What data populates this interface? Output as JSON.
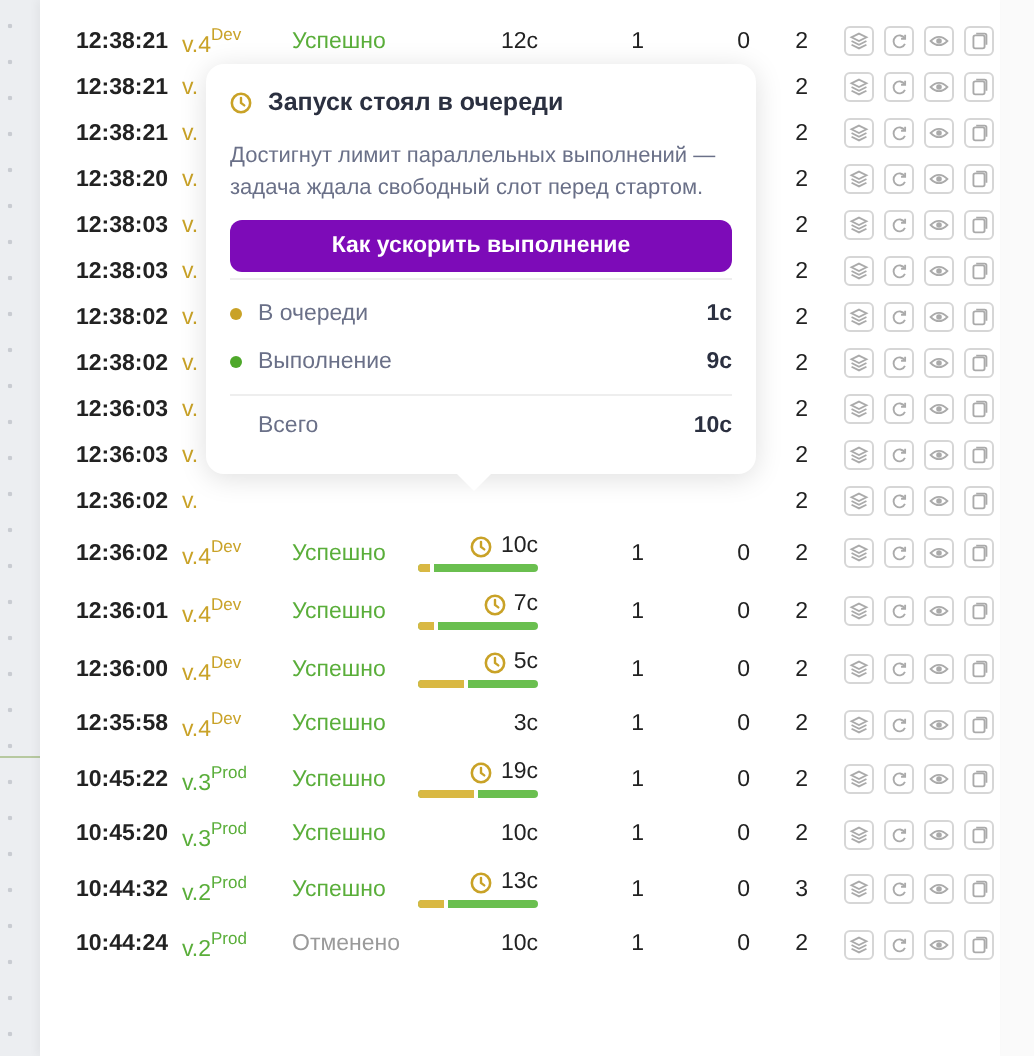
{
  "rows": [
    {
      "time": "12:38:21",
      "version": "v.4",
      "env": "Dev",
      "color": "#c9a227",
      "status": "Успешно",
      "cancelled": false,
      "duration": "12с",
      "col_1": "1",
      "col_2": "0",
      "col_3": "2"
    },
    {
      "time": "12:38:21",
      "version": "v.",
      "col_3": "2"
    },
    {
      "time": "12:38:21",
      "version": "v.",
      "col_3": "2"
    },
    {
      "time": "12:38:20",
      "version": "v.",
      "col_3": "2"
    },
    {
      "time": "12:38:03",
      "version": "v.",
      "col_3": "2"
    },
    {
      "time": "12:38:03",
      "version": "v.",
      "col_3": "2"
    },
    {
      "time": "12:38:02",
      "version": "v.",
      "col_3": "2"
    },
    {
      "time": "12:38:02",
      "version": "v.",
      "col_3": "2"
    },
    {
      "time": "12:36:03",
      "version": "v.",
      "col_3": "2"
    },
    {
      "time": "12:36:03",
      "version": "v.",
      "col_3": "2"
    },
    {
      "time": "12:36:02",
      "version": "v.",
      "col_3": "2"
    },
    {
      "time": "12:36:02",
      "version": "v.4",
      "env": "Dev",
      "color": "#c9a227",
      "status": "Успешно",
      "cancelled": false,
      "duration": "10с",
      "queued": true,
      "level": 0.1,
      "col_1": "1",
      "col_2": "0",
      "col_3": "2"
    },
    {
      "time": "12:36:01",
      "version": "v.4",
      "env": "Dev",
      "color": "#c9a227",
      "status": "Успешно",
      "cancelled": false,
      "duration": "7с",
      "queued": true,
      "level": 0.13,
      "col_1": "1",
      "col_2": "0",
      "col_3": "2"
    },
    {
      "time": "12:36:00",
      "version": "v.4",
      "env": "Dev",
      "color": "#c9a227",
      "status": "Успешно",
      "cancelled": false,
      "duration": "5с",
      "queued": true,
      "level": 0.39,
      "col_1": "1",
      "col_2": "0",
      "col_3": "2"
    },
    {
      "time": "12:35:58",
      "version": "v.4",
      "env": "Dev",
      "color": "#c9a227",
      "status": "Успешно",
      "cancelled": false,
      "duration": "3с",
      "queued": false,
      "col_1": "1",
      "col_2": "0",
      "col_3": "2"
    },
    {
      "time": "10:45:22",
      "version": "v.3",
      "env": "Prod",
      "color": "#5aae3a",
      "status": "Успешно",
      "cancelled": false,
      "duration": "19с",
      "queued": true,
      "level": 0.47,
      "col_1": "1",
      "col_2": "0",
      "col_3": "2"
    },
    {
      "time": "10:45:20",
      "version": "v.3",
      "env": "Prod",
      "color": "#5aae3a",
      "status": "Успешно",
      "cancelled": false,
      "duration": "10с",
      "queued": false,
      "col_1": "1",
      "col_2": "0",
      "col_3": "2"
    },
    {
      "time": "10:44:32",
      "version": "v.2",
      "env": "Prod",
      "color": "#5aae3a",
      "status": "Успешно",
      "cancelled": false,
      "duration": "13с",
      "queued": true,
      "level": 0.22,
      "col_1": "1",
      "col_2": "0",
      "col_3": "3"
    },
    {
      "time": "10:44:24",
      "version": "v.2",
      "env": "Prod",
      "color": "#5aae3a",
      "status": "Отменено",
      "cancelled": true,
      "duration": "10с",
      "queued": false,
      "col_1": "1",
      "col_2": "0",
      "col_3": "2"
    }
  ],
  "tooltip": {
    "title": "Запуск стоял в очереди",
    "description": "Достигнут лимит параллельных выполнений — задача ждала свободный слот перед стартом.",
    "button": "Как ускорить выполнение",
    "items": [
      {
        "label": "В очереди",
        "value": "1с",
        "color": "#c9a227"
      },
      {
        "label": "Выполнение",
        "value": "9с",
        "color": "#4ea82a"
      }
    ],
    "total": {
      "label": "Всего",
      "value": "10с"
    }
  }
}
